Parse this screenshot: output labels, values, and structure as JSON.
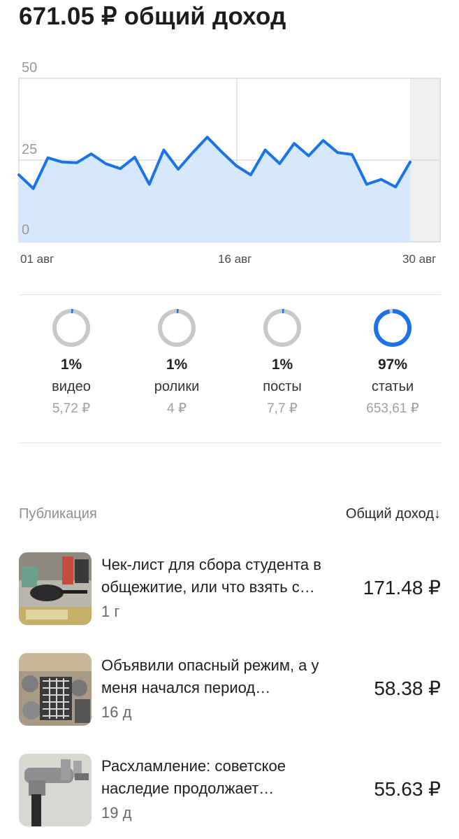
{
  "header": {
    "total_income": "671.05 ₽ общий доход"
  },
  "chart_data": {
    "type": "area",
    "y_ticks": [
      "50",
      "25",
      "0"
    ],
    "ylim": [
      0,
      50
    ],
    "x_tick_labels": [
      "01 авг",
      "16 авг",
      "30 авг"
    ],
    "x": [
      "01 авг",
      "02 авг",
      "03 авг",
      "04 авг",
      "05 авг",
      "06 авг",
      "07 авг",
      "08 авг",
      "09 авг",
      "10 авг",
      "11 авг",
      "12 авг",
      "13 авг",
      "14 авг",
      "15 авг",
      "16 авг",
      "17 авг",
      "18 авг",
      "19 авг",
      "20 авг",
      "21 авг",
      "22 авг",
      "23 авг",
      "24 авг",
      "25 авг",
      "26 авг",
      "27 авг",
      "28 авг",
      "29 авг",
      "30 авг"
    ],
    "values": [
      20.5,
      16.3,
      25.7,
      24.4,
      24.2,
      26.9,
      23.9,
      22.4,
      25.9,
      17.6,
      28.1,
      22.2,
      27.3,
      32.0,
      27.5,
      23.3,
      20.5,
      28.1,
      23.9,
      30.1,
      26.3,
      31.0,
      27.3,
      26.7,
      17.6,
      19.1,
      16.8,
      24.4
    ],
    "series_color": "#1a73e8",
    "fill_color": "#d6e8fb",
    "grid": true
  },
  "breakdown": [
    {
      "pct": "1%",
      "label": "видео",
      "amount": "5,72 ₽",
      "fraction": 0.01
    },
    {
      "pct": "1%",
      "label": "ролики",
      "amount": "4 ₽",
      "fraction": 0.01
    },
    {
      "pct": "1%",
      "label": "посты",
      "amount": "7,7 ₽",
      "fraction": 0.01
    },
    {
      "pct": "97%",
      "label": "статьи",
      "amount": "653,61 ₽",
      "fraction": 0.97
    }
  ],
  "list": {
    "column_left": "Публикация",
    "column_right": "Общий доход↓",
    "items": [
      {
        "title": "Чек-лист для сбора студента в общежитие, или что взять с…",
        "age": "1 г",
        "amount": "171.48 ₽"
      },
      {
        "title": "Объявили опасный режим, а у меня начался период…",
        "age": "16 д",
        "amount": "58.38 ₽"
      },
      {
        "title": "Расхламление: советское наследие продолжает…",
        "age": "19 д",
        "amount": "55.63 ₽"
      }
    ]
  },
  "colors": {
    "accent": "#1a73e8",
    "ring_track": "#c8c8c8"
  }
}
